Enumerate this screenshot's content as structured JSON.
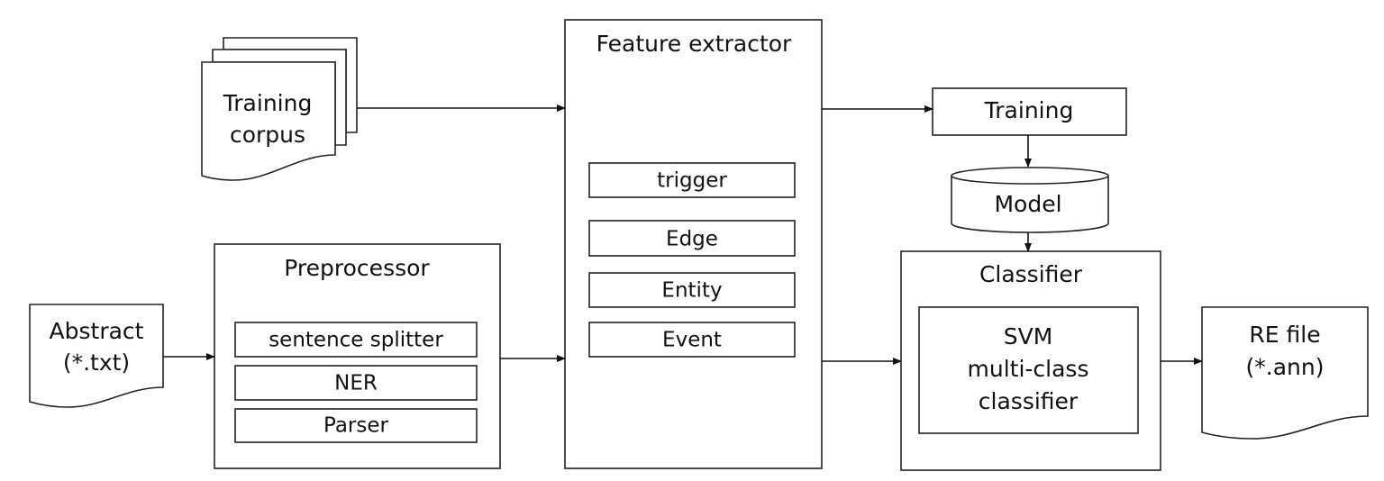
{
  "training_corpus": {
    "line1": "Training",
    "line2": "corpus"
  },
  "abstract": {
    "line1": "Abstract",
    "line2": "(*.txt)"
  },
  "preprocessor": {
    "title": "Preprocessor",
    "items": [
      "sentence splitter",
      "NER",
      "Parser"
    ]
  },
  "feature_extractor": {
    "title": "Feature extractor",
    "items": [
      "trigger",
      "Edge",
      "Entity",
      "Event"
    ]
  },
  "training": {
    "label": "Training"
  },
  "model": {
    "label": "Model"
  },
  "classifier": {
    "title": "Classifier",
    "inner": {
      "line1": "SVM",
      "line2": "multi-class",
      "line3": "classifier"
    }
  },
  "re_file": {
    "line1": "RE file",
    "line2": "(*.ann)"
  }
}
